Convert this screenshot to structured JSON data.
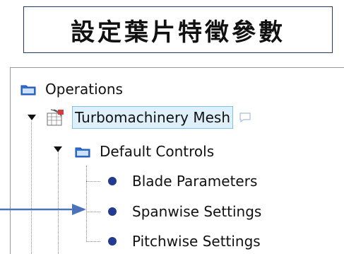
{
  "heading": {
    "title": "設定葉片特徵參數"
  },
  "tree": {
    "root": {
      "label": "Operations",
      "icon": "folder-icon"
    },
    "mesh": {
      "label": "Turbomachinery Mesh",
      "icon": "mesh-icon",
      "selected": true
    },
    "controls": {
      "label": "Default Controls",
      "icon": "folder-icon"
    },
    "items": [
      {
        "label": "Blade Parameters",
        "icon": "bullet-icon"
      },
      {
        "label": "Spanwise Settings",
        "icon": "bullet-icon"
      },
      {
        "label": "Pitchwise Settings",
        "icon": "bullet-icon"
      }
    ]
  },
  "colors": {
    "folder": "#2e6fd6",
    "bullet": "#233a8f",
    "selection_bg": "#dff0fb",
    "selection_border": "#7fc0e8",
    "pointer_arrow": "#4a73b8"
  },
  "annotation": {
    "pointer_arrow_target": "Spanwise Settings"
  }
}
